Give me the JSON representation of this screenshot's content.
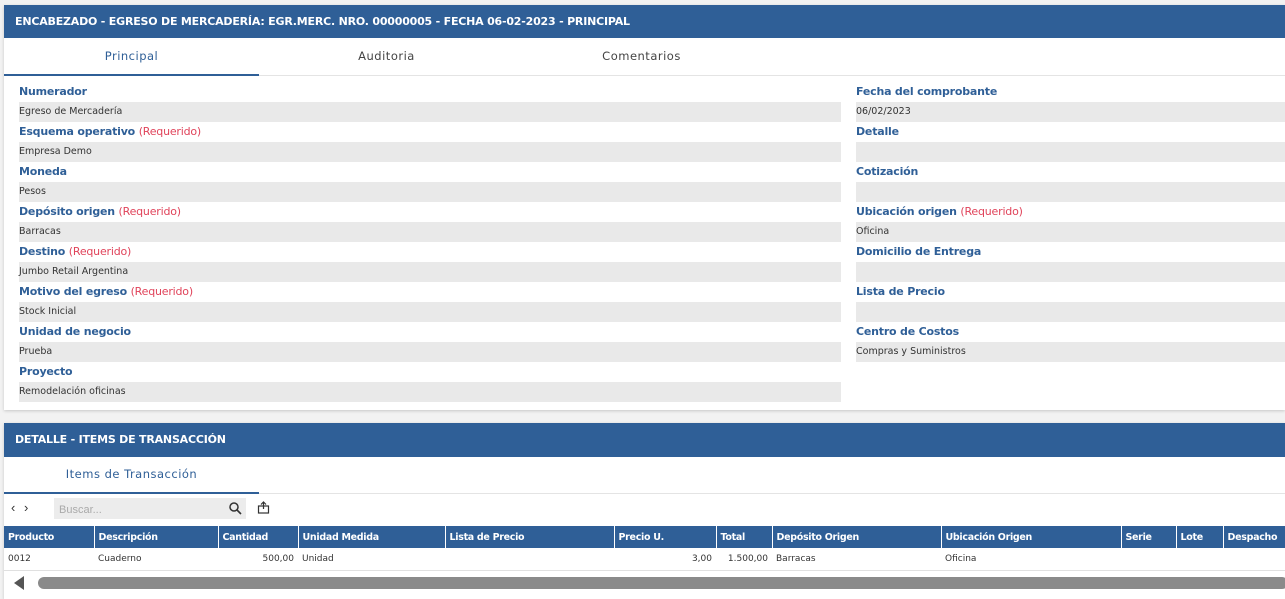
{
  "header": {
    "title": "ENCABEZADO - EGRESO DE MERCADERÍA: EGR.MERC. NRO. 00000005 - FECHA 06-02-2023 - PRINCIPAL",
    "tabs": [
      "Principal",
      "Auditoria",
      "Comentarios"
    ],
    "active_tab": "Principal"
  },
  "required_text": "(Requerido)",
  "fields_left": [
    {
      "label": "Numerador",
      "value": "Egreso de Mercadería",
      "required": false
    },
    {
      "label": "Esquema operativo",
      "value": "Empresa Demo",
      "required": true
    },
    {
      "label": "Moneda",
      "value": "Pesos",
      "required": false
    },
    {
      "label": "Depósito origen",
      "value": "Barracas",
      "required": true
    },
    {
      "label": "Destino",
      "value": "Jumbo Retail Argentina",
      "required": true
    },
    {
      "label": "Motivo del egreso",
      "value": "Stock Inicial",
      "required": true
    },
    {
      "label": "Unidad de negocio",
      "value": "Prueba",
      "required": false
    },
    {
      "label": "Proyecto",
      "value": "Remodelación oficinas",
      "required": false
    }
  ],
  "fields_right": [
    {
      "label": "Fecha del comprobante",
      "value": "06/02/2023",
      "required": false
    },
    {
      "label": "Detalle",
      "value": "",
      "required": false
    },
    {
      "label": "Cotización",
      "value": "",
      "required": false
    },
    {
      "label": "Ubicación origen",
      "value": "Oficina",
      "required": true
    },
    {
      "label": "Domicilio de Entrega",
      "value": "",
      "required": false
    },
    {
      "label": "Lista de Precio",
      "value": "",
      "required": false
    },
    {
      "label": "Centro de Costos",
      "value": "Compras y Suministros",
      "required": false
    }
  ],
  "detail": {
    "title": "DETALLE - ITEMS DE TRANSACCIÓN",
    "tab": "Items de Transacción",
    "search_placeholder": "Buscar...",
    "columns": [
      "Producto",
      "Descripción",
      "Cantidad",
      "Unidad Medida",
      "Lista de Precio",
      "Precio U.",
      "Total",
      "Depósito Origen",
      "Ubicación Origen",
      "Serie",
      "Lote",
      "Despacho"
    ],
    "rows": [
      [
        "0012",
        "Cuaderno",
        "500,00",
        "Unidad",
        "",
        "3,00",
        "1.500,00",
        "Barracas",
        "Oficina",
        "",
        "",
        ""
      ]
    ]
  },
  "colors": {
    "primary": "#2f5f97",
    "required": "#e0435a",
    "field_bg": "#e9e9e9"
  },
  "icons": [
    "chevron-left-icon",
    "chevron-right-icon",
    "search-icon",
    "export-icon",
    "scroll-left-icon"
  ]
}
